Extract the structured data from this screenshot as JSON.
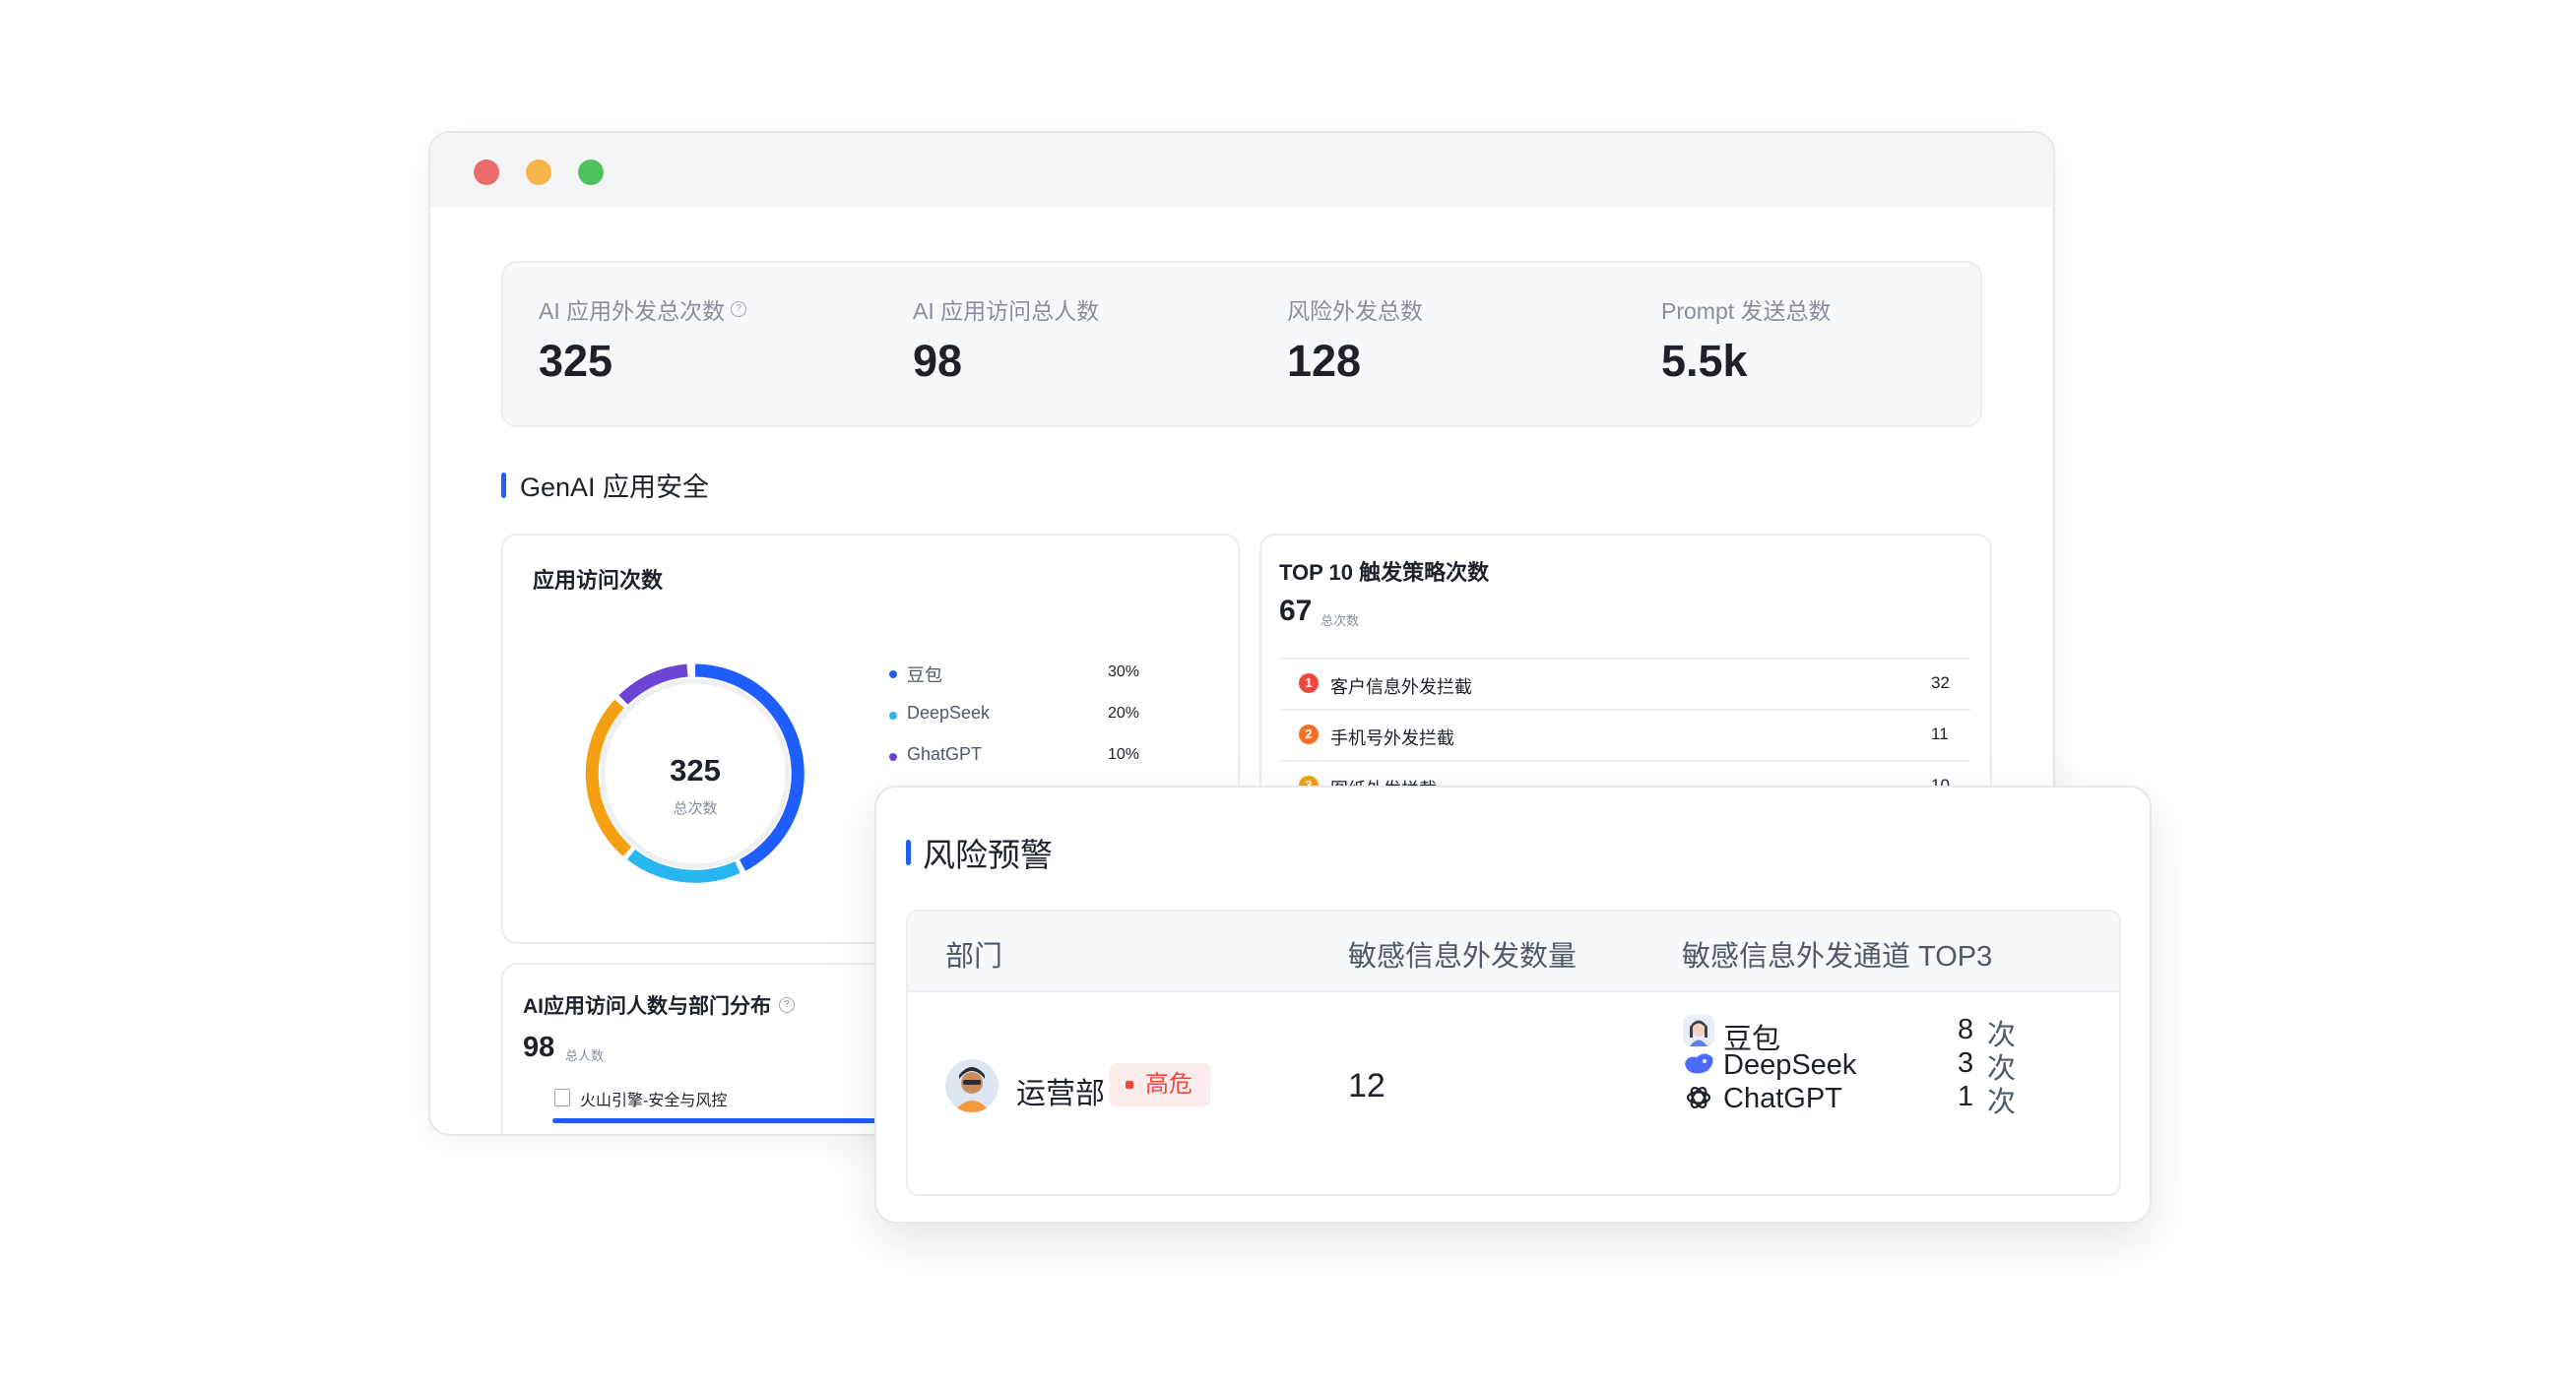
{
  "stats": [
    {
      "label": "AI 应用外发总次数",
      "value": "325",
      "help": true
    },
    {
      "label": "AI 应用访问总人数",
      "value": "98"
    },
    {
      "label": "风险外发总数",
      "value": "128"
    },
    {
      "label": "Prompt 发送总数",
      "value": "5.5k"
    }
  ],
  "section": {
    "title": "GenAI 应用安全"
  },
  "app_visits": {
    "title": "应用访问次数",
    "total": "325",
    "total_label": "总次数",
    "legend": [
      {
        "name": "豆包",
        "pct": "30%",
        "color": "#1e5eff"
      },
      {
        "name": "DeepSeek",
        "pct": "20%",
        "color": "#27b6f0"
      },
      {
        "name": "GhatGPT",
        "pct": "10%",
        "color": "#6b45d6"
      }
    ],
    "ring_colors": [
      "#1e5eff",
      "#27b6f0",
      "#f4a012",
      "#6b45d6"
    ]
  },
  "top10": {
    "title": "TOP 10 触发策略次数",
    "total": "67",
    "total_label": "总次数",
    "rows": [
      {
        "rank": "1",
        "name": "客户信息外发拦截",
        "value": "32",
        "color": "#f0483e"
      },
      {
        "rank": "2",
        "name": "手机号外发拦截",
        "value": "11",
        "color": "#f56e23"
      },
      {
        "rank": "3",
        "name": "图纸外发拦截",
        "value": "10",
        "color": "#f4a012"
      }
    ]
  },
  "dept_dist": {
    "title": "AI应用访问人数与部门分布",
    "total": "98",
    "total_label": "总人数",
    "row_label": "火山引擎-安全与风控"
  },
  "risk": {
    "title": "风险预警",
    "headers": {
      "dept": "部门",
      "count": "敏感信息外发数量",
      "channels": "敏感信息外发通道 TOP3"
    },
    "row": {
      "dept": "运营部",
      "level": "高危",
      "count": "12",
      "channels": [
        {
          "name": "豆包",
          "count": "8",
          "unit": "次",
          "icon": "doubao-icon"
        },
        {
          "name": "DeepSeek",
          "count": "3",
          "unit": "次",
          "icon": "deepseek-icon"
        },
        {
          "name": "ChatGPT",
          "count": "1",
          "unit": "次",
          "icon": "chatgpt-icon"
        }
      ]
    }
  }
}
